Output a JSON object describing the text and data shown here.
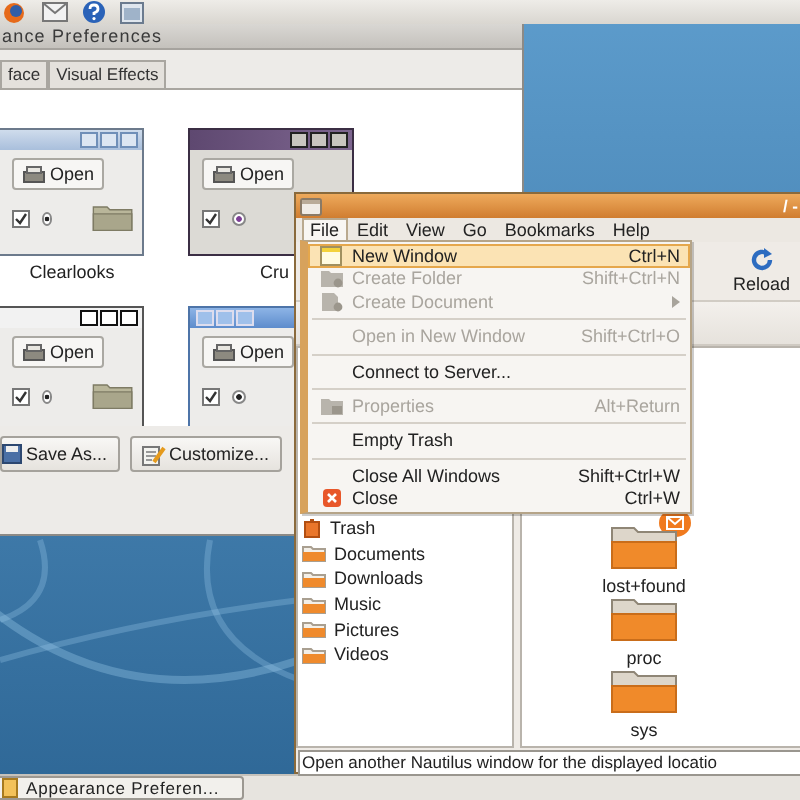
{
  "appearance_window": {
    "title": "ance Preferences",
    "tabs": [
      {
        "label": "face",
        "selected": false
      },
      {
        "label": "Visual Effects",
        "selected": false
      }
    ],
    "themes": [
      {
        "name": "Clearlooks",
        "kind": "clearlooks",
        "button": "Open",
        "checked": true,
        "radio_on": true
      },
      {
        "name": "Cru",
        "kind": "crux",
        "button": "Open",
        "checked": true,
        "radio_on": true
      },
      {
        "kind": "mist",
        "button": "Open",
        "checked": true,
        "radio_on": true
      },
      {
        "kind": "glossy",
        "button": "Open",
        "checked": true,
        "radio_on": true
      }
    ],
    "buttons": [
      "Save As...",
      "Customize..."
    ]
  },
  "file_manager": {
    "title": "/ -",
    "menu_bar": [
      {
        "label": "File",
        "selected": true
      },
      {
        "label": "Edit",
        "selected": false
      },
      {
        "label": "View",
        "selected": false
      },
      {
        "label": "Go",
        "selected": false
      },
      {
        "label": "Bookmarks",
        "selected": false
      },
      {
        "label": "Help",
        "selected": false
      }
    ],
    "toolbar": {
      "reload": "Reload"
    },
    "sidebar": [
      "Trash",
      "Documents",
      "Downloads",
      "Music",
      "Pictures",
      "Videos"
    ],
    "files": [
      {
        "name": "lost+found",
        "emblem": true
      },
      {
        "name": "proc",
        "emblem": false
      },
      {
        "name": "sys",
        "emblem": false
      }
    ],
    "status_bar": "Open another Nautilus window for the displayed locatio"
  },
  "file_menu": [
    {
      "kind": "item",
      "label": "New Window",
      "shortcut": "Ctrl+N",
      "disabled": false,
      "selected": true
    },
    {
      "kind": "item",
      "label": "Create Folder",
      "shortcut": "Shift+Ctrl+N",
      "disabled": true,
      "selected": false
    },
    {
      "kind": "item",
      "label": "Create Document",
      "submenu": true,
      "disabled": true,
      "selected": false
    },
    {
      "kind": "separator"
    },
    {
      "kind": "item",
      "label": "Open in New Window",
      "shortcut": "Shift+Ctrl+O",
      "disabled": true,
      "selected": false
    },
    {
      "kind": "separator"
    },
    {
      "kind": "item",
      "label": "Connect to Server...",
      "disabled": false,
      "selected": false
    },
    {
      "kind": "separator"
    },
    {
      "kind": "item",
      "label": "Properties",
      "shortcut": "Alt+Return",
      "disabled": true,
      "selected": false
    },
    {
      "kind": "separator"
    },
    {
      "kind": "item",
      "label": "Empty Trash",
      "disabled": false,
      "selected": false
    },
    {
      "kind": "separator"
    },
    {
      "kind": "item",
      "label": "Close All Windows",
      "shortcut": "Shift+Ctrl+W",
      "disabled": false,
      "selected": false
    },
    {
      "kind": "item",
      "label": "Close",
      "shortcut": "Ctrl+W",
      "disabled": false,
      "selected": false
    }
  ],
  "taskbar": [
    {
      "label": "Appearance Preferen...",
      "selected": false
    }
  ]
}
